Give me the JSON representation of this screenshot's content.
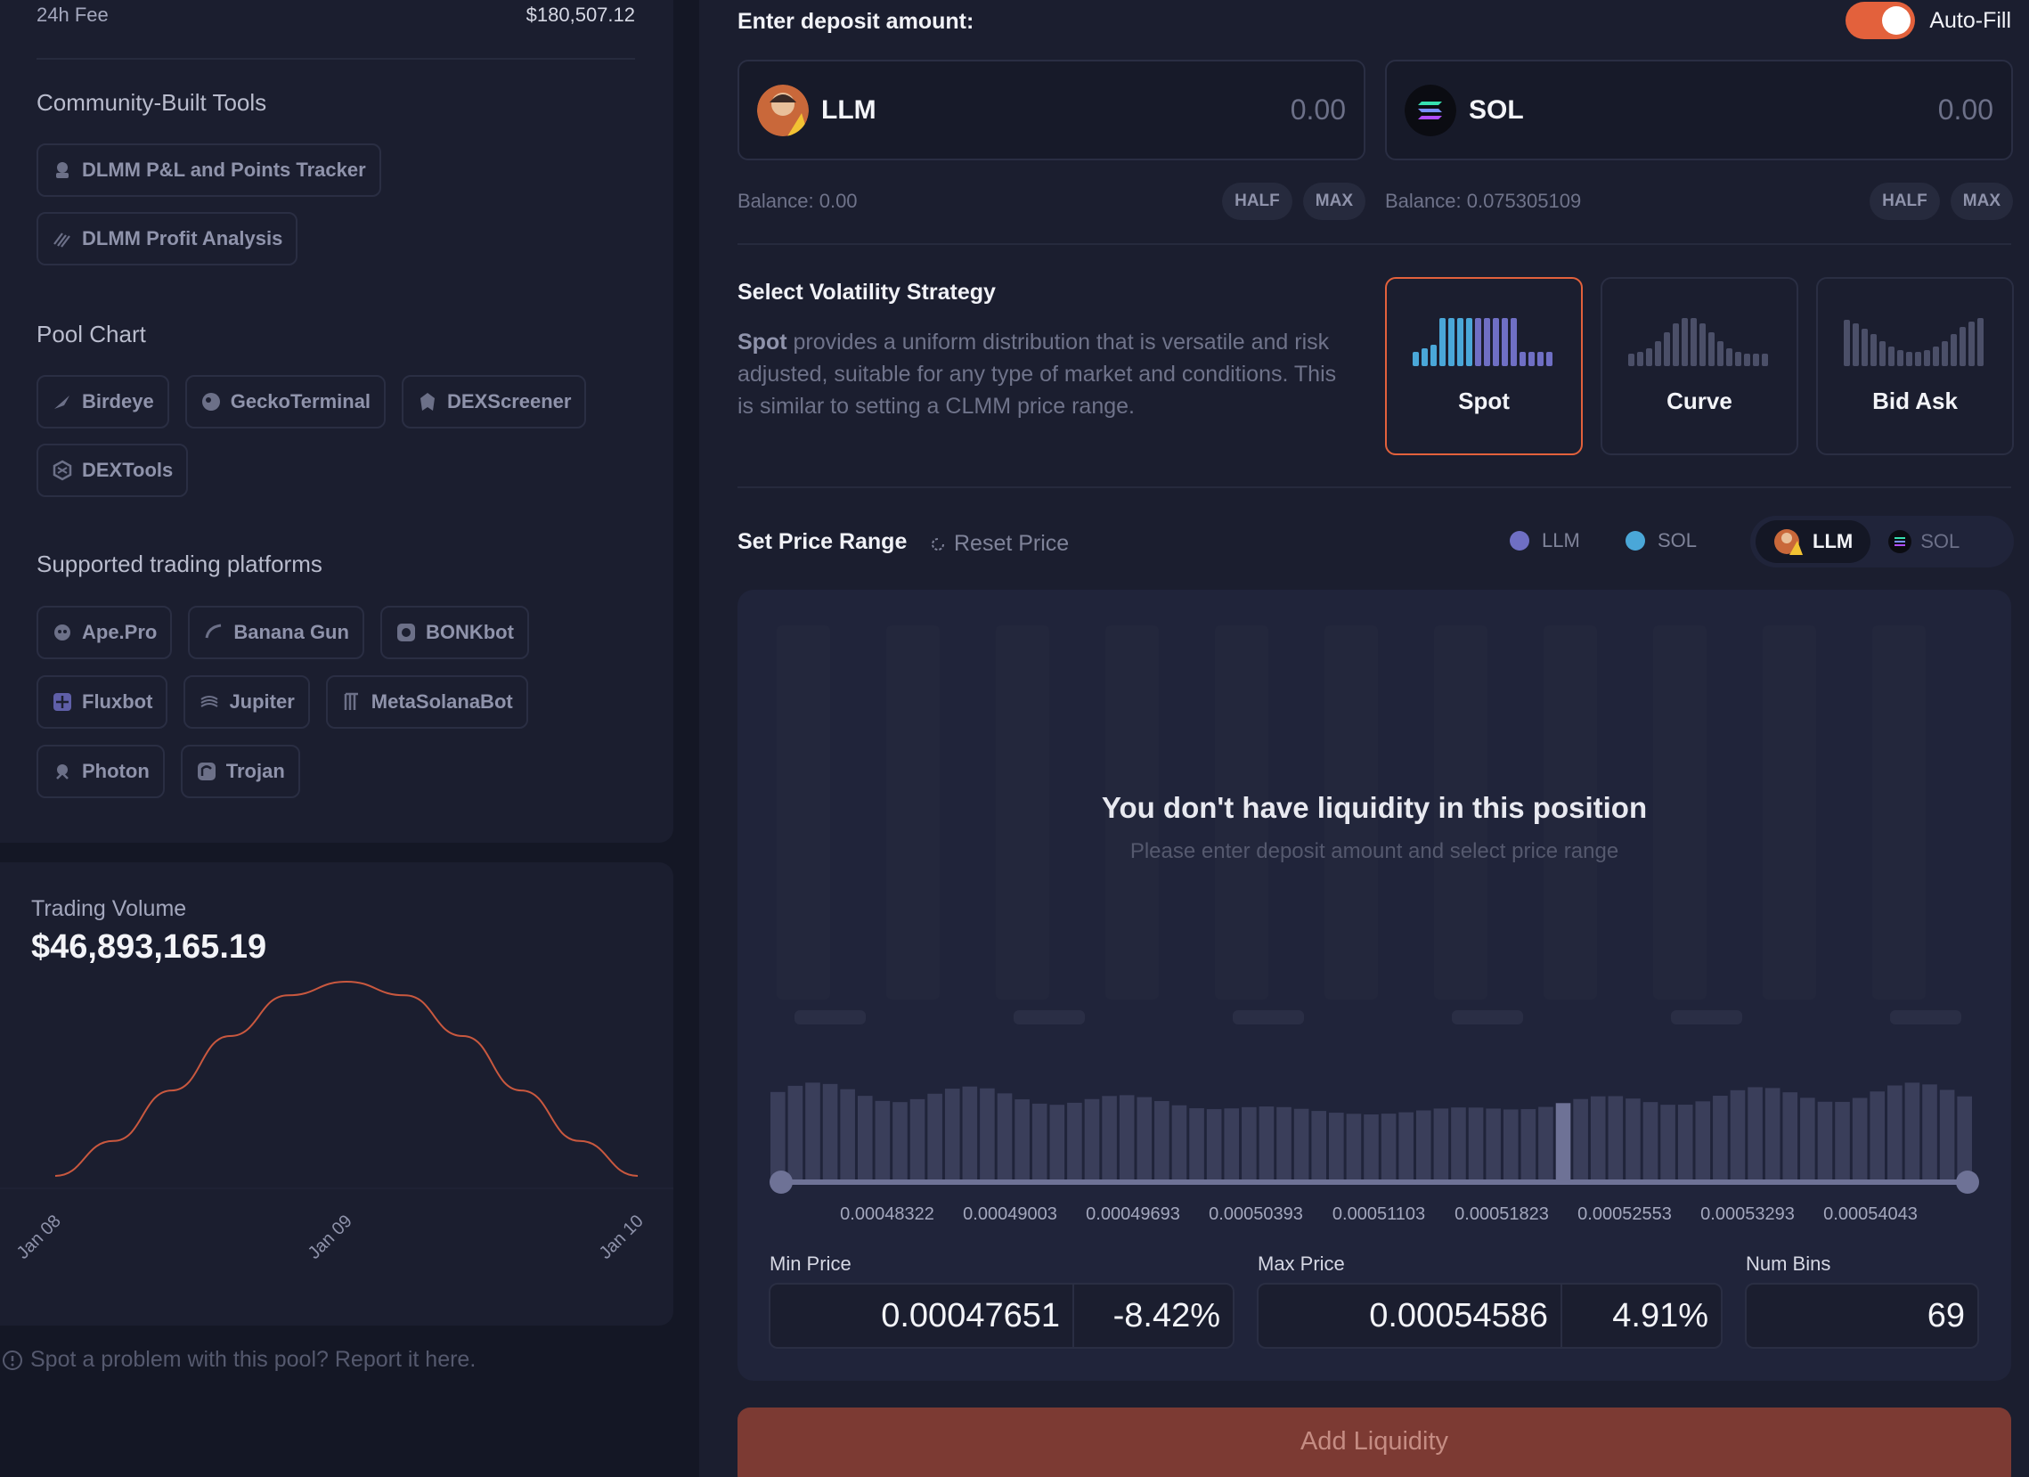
{
  "stats": {
    "fee_label": "24h Fee",
    "fee_value": "$180,507.12"
  },
  "community_tools": {
    "title": "Community-Built Tools",
    "items": [
      {
        "label": "DLMM P&L and Points Tracker",
        "icon": "tracker-icon"
      },
      {
        "label": "DLMM Profit Analysis",
        "icon": "stripes-icon"
      }
    ]
  },
  "pool_chart": {
    "title": "Pool Chart",
    "items": [
      {
        "label": "Birdeye",
        "icon": "bird-icon"
      },
      {
        "label": "GeckoTerminal",
        "icon": "gecko-icon"
      },
      {
        "label": "DEXScreener",
        "icon": "dexscreener-icon"
      },
      {
        "label": "DEXTools",
        "icon": "dextools-icon"
      }
    ]
  },
  "platforms": {
    "title": "Supported trading platforms",
    "items": [
      {
        "label": "Ape.Pro",
        "icon": "ape-icon"
      },
      {
        "label": "Banana Gun",
        "icon": "banana-icon"
      },
      {
        "label": "BONKbot",
        "icon": "bonk-icon"
      },
      {
        "label": "Fluxbot",
        "icon": "flux-icon"
      },
      {
        "label": "Jupiter",
        "icon": "jupiter-icon"
      },
      {
        "label": "MetaSolanaBot",
        "icon": "meta-icon"
      },
      {
        "label": "Photon",
        "icon": "photon-icon"
      },
      {
        "label": "Trojan",
        "icon": "trojan-icon"
      }
    ]
  },
  "trading_volume": {
    "label": "Trading Volume",
    "value": "$46,893,165.19",
    "line_color": "#c9583f"
  },
  "chart_data": {
    "type": "line",
    "title": "",
    "xlabel": "",
    "ylabel": "",
    "x": [
      "Jan 08",
      "",
      "",
      "",
      "",
      "Jan 09",
      "",
      "",
      "",
      "",
      "Jan 10"
    ],
    "tick_labels": [
      "Jan 08",
      "Jan 09",
      "Jan 10"
    ],
    "series": [
      {
        "values": [
          0.0,
          0.18,
          0.44,
          0.72,
          0.93,
          1.0,
          0.93,
          0.72,
          0.44,
          0.18,
          0.0
        ]
      }
    ],
    "ylim": [
      0,
      1
    ],
    "grid": false,
    "legend": "none"
  },
  "report": {
    "text": "Spot a problem with this pool? Report it here."
  },
  "deposit": {
    "title": "Enter deposit amount:",
    "autofill_label": "Auto-Fill",
    "autofill_on": true,
    "token_a": {
      "symbol": "LLM",
      "amount": "0.00",
      "balance": "Balance: 0.00",
      "half": "HALF",
      "max": "MAX"
    },
    "token_b": {
      "symbol": "SOL",
      "amount": "0.00",
      "balance": "Balance: 0.075305109",
      "half": "HALF",
      "max": "MAX"
    }
  },
  "strategy": {
    "title": "Select Volatility Strategy",
    "desc_bold": "Spot",
    "desc_rest": " provides a uniform distribution that is versatile and risk adjusted, suitable for any type of market and conditions. This is similar to setting a CLMM price range.",
    "options": [
      {
        "label": "Spot",
        "selected": true
      },
      {
        "label": "Curve",
        "selected": false
      },
      {
        "label": "Bid Ask",
        "selected": false
      }
    ]
  },
  "price_range": {
    "title": "Set Price Range",
    "reset_label": "Reset Price",
    "legend": [
      {
        "label": "LLM",
        "color": "#6f6fc4"
      },
      {
        "label": "SOL",
        "color": "#4aa7d8"
      }
    ],
    "toggle": [
      {
        "label": "LLM",
        "active": true
      },
      {
        "label": "SOL",
        "active": false
      }
    ],
    "empty_title": "You don't have liquidity in this position",
    "empty_sub": "Please enter deposit amount and select price range",
    "ticks": [
      "0.00048322",
      "0.00049003",
      "0.00049693",
      "0.00050393",
      "0.00051103",
      "0.00051823",
      "0.00052553",
      "0.00053293",
      "0.00054043"
    ],
    "min_label": "Min Price",
    "min_value": "0.00047651",
    "min_pct": "-8.42%",
    "max_label": "Max Price",
    "max_value": "0.00054586",
    "max_pct": "4.91%",
    "bins_label": "Num Bins",
    "bins_value": "69"
  },
  "action": {
    "label": "Add Liquidity"
  }
}
